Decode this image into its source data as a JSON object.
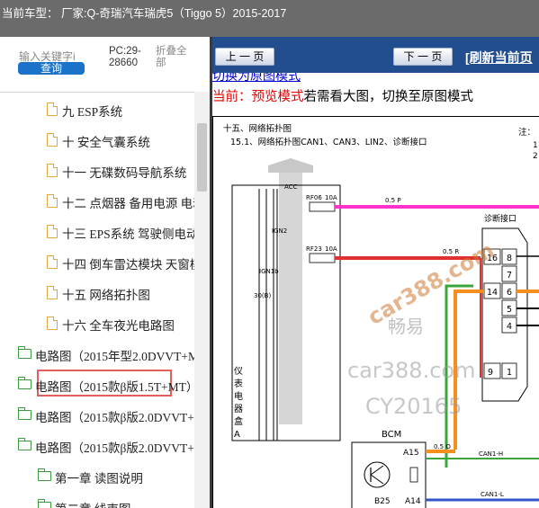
{
  "header": {
    "title": "当前车型：  厂家:Q-奇瑞汽车瑞虎5（Tiggo 5）2015-2017"
  },
  "sidebar": {
    "keyword_placeholder": "输入关键字i",
    "query_label": "查询",
    "pc_code": "PC:29-28660",
    "collapse_label": "折叠全部",
    "items": [
      {
        "label": "九 ESP系统",
        "type": "page"
      },
      {
        "label": "十 安全气囊系统",
        "type": "page"
      },
      {
        "label": "十一 无碟数码导航系统",
        "type": "page"
      },
      {
        "label": "十二 点烟器 备用电源 电动",
        "type": "page"
      },
      {
        "label": "十三 EPS系统 驾驶侧电动",
        "type": "page"
      },
      {
        "label": "十四 倒车雷达模块 天窗模",
        "type": "page"
      },
      {
        "label": "十五 网络拓扑图",
        "type": "page",
        "selected": true
      },
      {
        "label": "十六 全车夜光电路图",
        "type": "page"
      },
      {
        "label": "电路图（2015年型2.0DVVT+M",
        "type": "folder"
      },
      {
        "label": "电路图（2015款β版1.5T+MT）",
        "type": "folder"
      },
      {
        "label": "电路图（2015款β版2.0DVVT+C",
        "type": "folder"
      },
      {
        "label": "电路图（2015款β版2.0DVVT+M",
        "type": "folder"
      },
      {
        "label": "第一章 读图说明",
        "type": "folder"
      },
      {
        "label": "第二章 线束图",
        "type": "folder"
      }
    ]
  },
  "toolbar": {
    "prev_label": "上 一 页",
    "next_label": "下 一 页",
    "refresh_label": "[刷新当前页"
  },
  "main": {
    "switch_link": "切换为原图模式",
    "preview_red": "当前：预览模式",
    "preview_rest": "若需看大图，切换至原图模式"
  },
  "diagram": {
    "title": "十五、网络拓扑图",
    "subtitle": "15.1、网络拓扑图CAN1、CAN3、LIN2、诊断接口",
    "note": "注：",
    "note_nums": [
      "1",
      "2"
    ],
    "acc": "ACC",
    "ign2": "IGN2",
    "ign1b": "IGN1b",
    "b30": "30(B)",
    "rf06": "RF06",
    "rf06_amp": "10A",
    "rf23": "RF23",
    "rf23_amp": "10A",
    "wire_p": "0.5 P",
    "wire_r": "0.5 R",
    "wire_o": "0.5 O",
    "diag_label": "诊断接口",
    "pins": [
      "16",
      "8",
      "7",
      "14",
      "6",
      "5",
      "4",
      "9",
      "1"
    ],
    "panel_label": [
      "仪",
      "表",
      "电",
      "器",
      "盒",
      "A"
    ],
    "bcm": "BCM",
    "a15": "A15",
    "b25": "B25",
    "a14": "A14",
    "can1h": "CAN1-H",
    "can1l": "CAN1-L",
    "watermarks": [
      "car388.com",
      "畅易",
      "car388.com",
      "CY20165"
    ],
    "colors": {
      "pink": "#ff33cc",
      "red": "#e03030",
      "orange": "#f5901e",
      "green": "#3aa53a",
      "blue": "#3355cc"
    }
  }
}
